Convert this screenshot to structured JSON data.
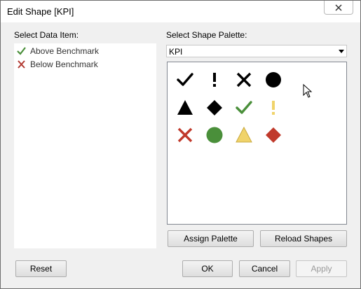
{
  "window": {
    "title": "Edit Shape [KPI]"
  },
  "left": {
    "heading": "Select Data Item:",
    "items": [
      {
        "label": "Above Benchmark",
        "icon": "check-green-icon",
        "color": "#4a8f3a"
      },
      {
        "label": "Below Benchmark",
        "icon": "x-red-icon",
        "color": "#b23a32"
      }
    ]
  },
  "right": {
    "heading": "Select Shape Palette:",
    "palette_value": "KPI",
    "shapes": [
      [
        "check-black-icon",
        "exclamation-black-icon",
        "x-black-icon",
        "circle-black-icon"
      ],
      [
        "triangle-black-icon",
        "diamond-black-icon",
        "check-green-icon",
        "exclamation-yellow-icon"
      ],
      [
        "x-red-icon",
        "circle-green-icon",
        "triangle-yellow-icon",
        "diamond-red-icon"
      ]
    ],
    "assign_palette": "Assign Palette",
    "reload_shapes": "Reload Shapes"
  },
  "footer": {
    "reset": "Reset",
    "ok": "OK",
    "cancel": "Cancel",
    "apply": "Apply"
  },
  "colors": {
    "green": "#4a8f3a",
    "red": "#c0392b",
    "yellow": "#f0d36a",
    "black": "#000000"
  }
}
